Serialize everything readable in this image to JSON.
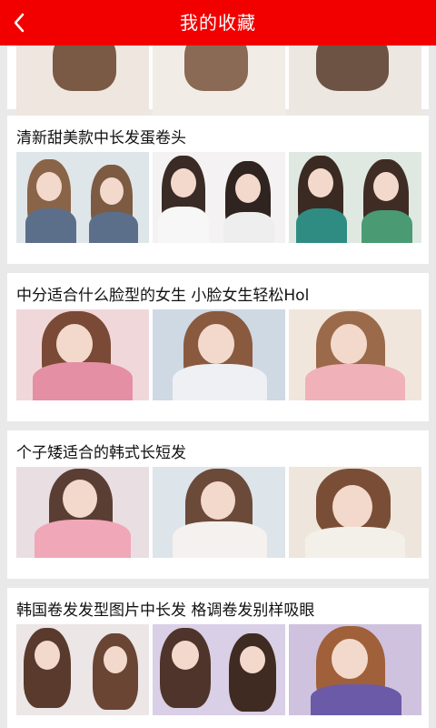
{
  "header": {
    "title": "我的收藏",
    "back_icon": "chevron-left-icon",
    "bg_color": "#f20000"
  },
  "favorites": [
    {
      "title": "",
      "thumbs": [
        "photo-1",
        "photo-2",
        "photo-3"
      ]
    },
    {
      "title": "清新甜美款中长发蛋卷头",
      "thumbs": [
        "photo-1",
        "photo-2",
        "photo-3"
      ]
    },
    {
      "title": "中分适合什么脸型的女生 小脸女生轻松Hol",
      "thumbs": [
        "photo-1",
        "photo-2",
        "photo-3"
      ]
    },
    {
      "title": "个子矮适合的韩式长短发",
      "thumbs": [
        "photo-1",
        "photo-2",
        "photo-3"
      ]
    },
    {
      "title": "韩国卷发发型图片中长发 格调卷发别样吸眼",
      "thumbs": [
        "photo-1",
        "photo-2",
        "photo-3"
      ]
    }
  ]
}
